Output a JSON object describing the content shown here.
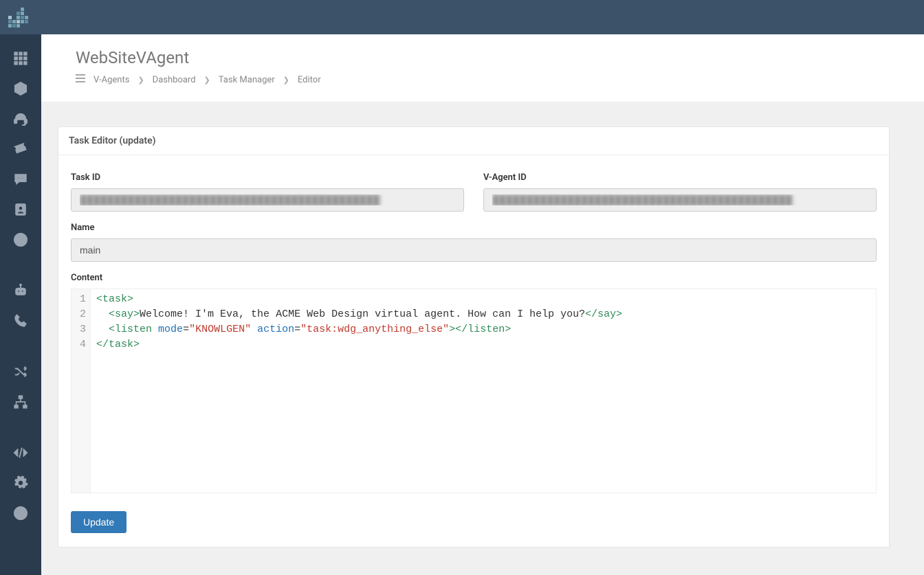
{
  "header": {
    "pageTitle": "WebSiteVAgent"
  },
  "breadcrumb": {
    "items": [
      "V-Agents",
      "Dashboard",
      "Task Manager",
      "Editor"
    ]
  },
  "panel": {
    "title": "Task Editor (update)"
  },
  "form": {
    "taskId": {
      "label": "Task ID",
      "value": "████████████████████████████████████████████"
    },
    "vagentId": {
      "label": "V-Agent ID",
      "value": "████████████████████████████████████████████"
    },
    "name": {
      "label": "Name",
      "value": "main"
    },
    "content": {
      "label": "Content"
    },
    "updateBtn": "Update"
  },
  "code": {
    "lines": [
      [
        {
          "t": "tag",
          "v": "<task>"
        }
      ],
      [
        {
          "t": "text",
          "v": "  "
        },
        {
          "t": "tag",
          "v": "<say>"
        },
        {
          "t": "text",
          "v": "Welcome! I'm Eva, the ACME Web Design virtual agent. How can I help you?"
        },
        {
          "t": "tag",
          "v": "</say>"
        }
      ],
      [
        {
          "t": "text",
          "v": "  "
        },
        {
          "t": "tag",
          "v": "<listen"
        },
        {
          "t": "text",
          "v": " "
        },
        {
          "t": "attr",
          "v": "mode"
        },
        {
          "t": "text",
          "v": "="
        },
        {
          "t": "str",
          "v": "\"KNOWLGEN\""
        },
        {
          "t": "text",
          "v": " "
        },
        {
          "t": "attr",
          "v": "action"
        },
        {
          "t": "text",
          "v": "="
        },
        {
          "t": "str",
          "v": "\"task:wdg_anything_else\""
        },
        {
          "t": "tag",
          "v": ">"
        },
        {
          "t": "tag",
          "v": "</listen>"
        }
      ],
      [
        {
          "t": "tag",
          "v": "</task>"
        }
      ]
    ]
  },
  "sidebar": {
    "items": [
      "grid",
      "hexagon",
      "headset",
      "ticket",
      "chat",
      "contact",
      "play",
      "gap",
      "robot",
      "phone",
      "gap",
      "shuffle",
      "sitemap",
      "gap",
      "code",
      "gear",
      "life-ring"
    ]
  }
}
